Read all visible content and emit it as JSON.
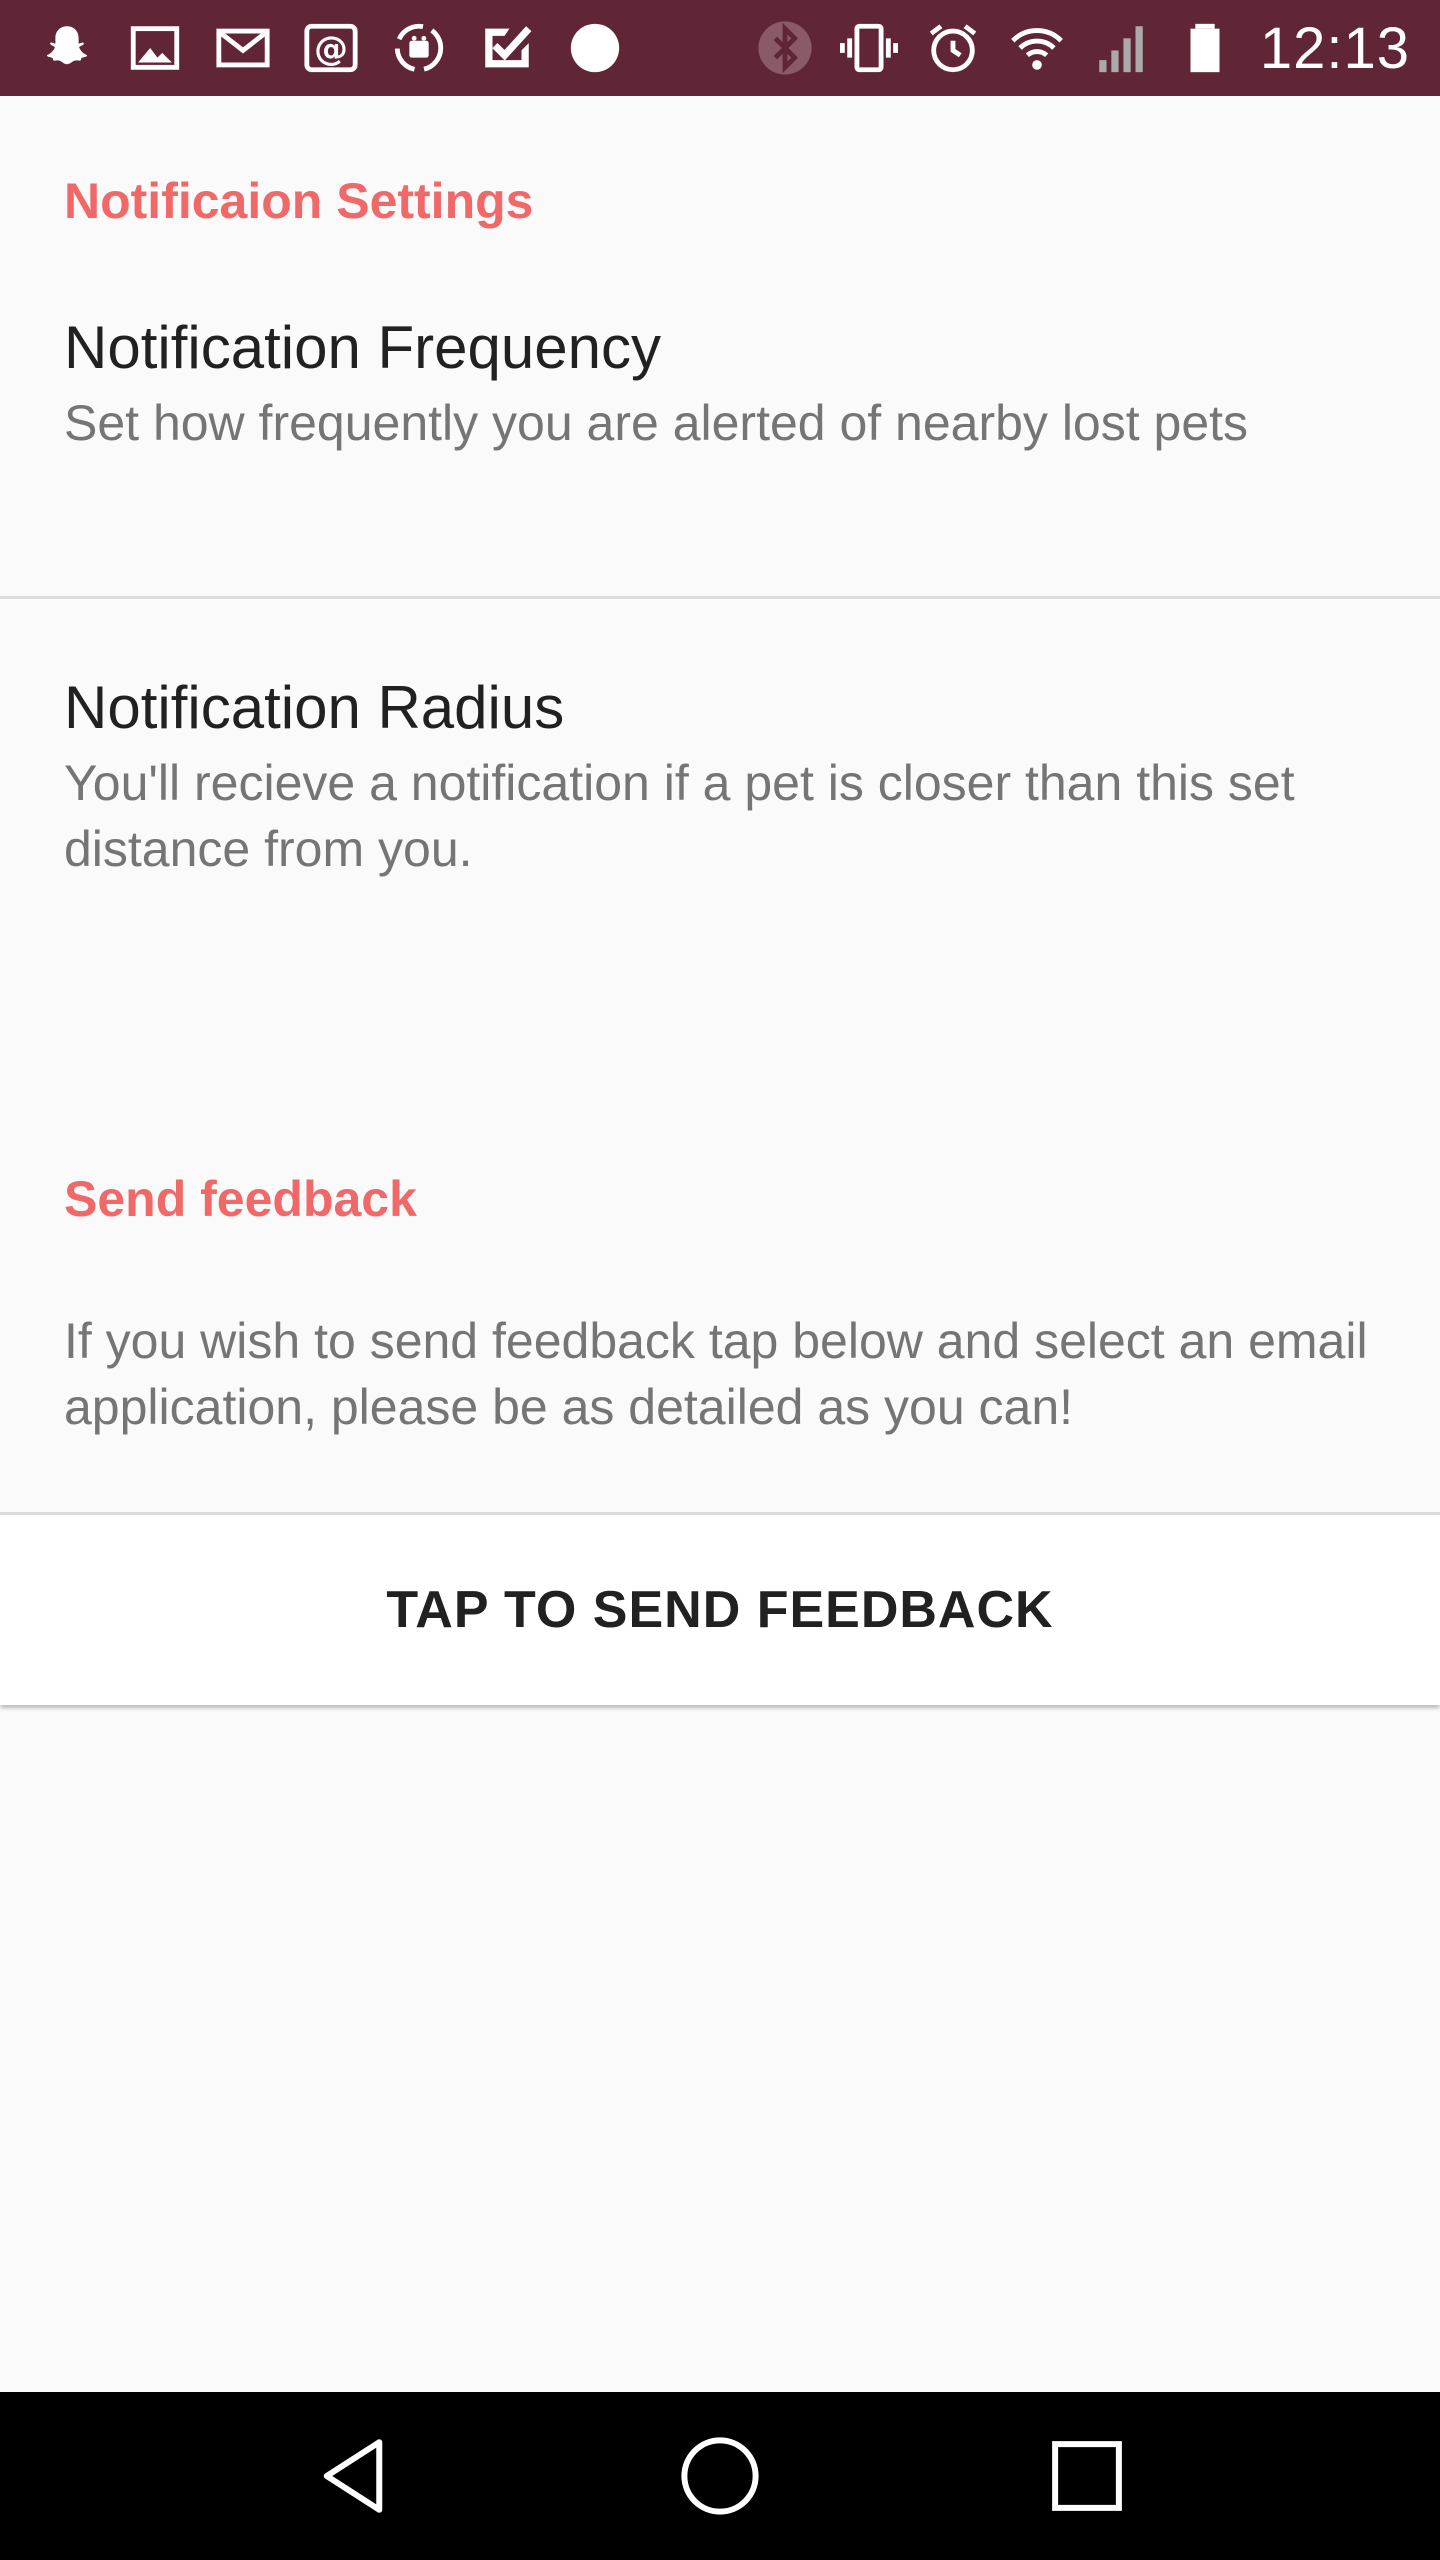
{
  "status_bar": {
    "time": "12:13",
    "left_icons": [
      "snapchat-icon",
      "image-icon",
      "gmail-icon",
      "email-at-icon",
      "android-sync-icon",
      "tasks-check-icon",
      "circle-notification-icon"
    ],
    "right_icons": [
      "bluetooth-icon",
      "vibrate-icon",
      "alarm-icon",
      "wifi-icon",
      "signal-icon",
      "battery-icon"
    ],
    "background": "#612636"
  },
  "notification_settings": {
    "header": "Notificaion Settings",
    "frequency": {
      "title": "Notification Frequency",
      "summary": "Set how frequently you are alerted of nearby lost pets"
    },
    "radius": {
      "title": "Notification Radius",
      "summary": "You'll recieve a notification if a pet is closer than this set distance from you."
    }
  },
  "feedback": {
    "header": "Send feedback",
    "description": "If you wish to send feedback tap below and select an email application, please be as detailed as you can!",
    "button_label": "TAP TO SEND FEEDBACK"
  },
  "nav_bar": {
    "buttons": [
      "back-icon",
      "home-icon",
      "recents-icon"
    ]
  },
  "colors": {
    "accent": "#f06868",
    "status_bar": "#612636",
    "background": "#fafafa"
  }
}
